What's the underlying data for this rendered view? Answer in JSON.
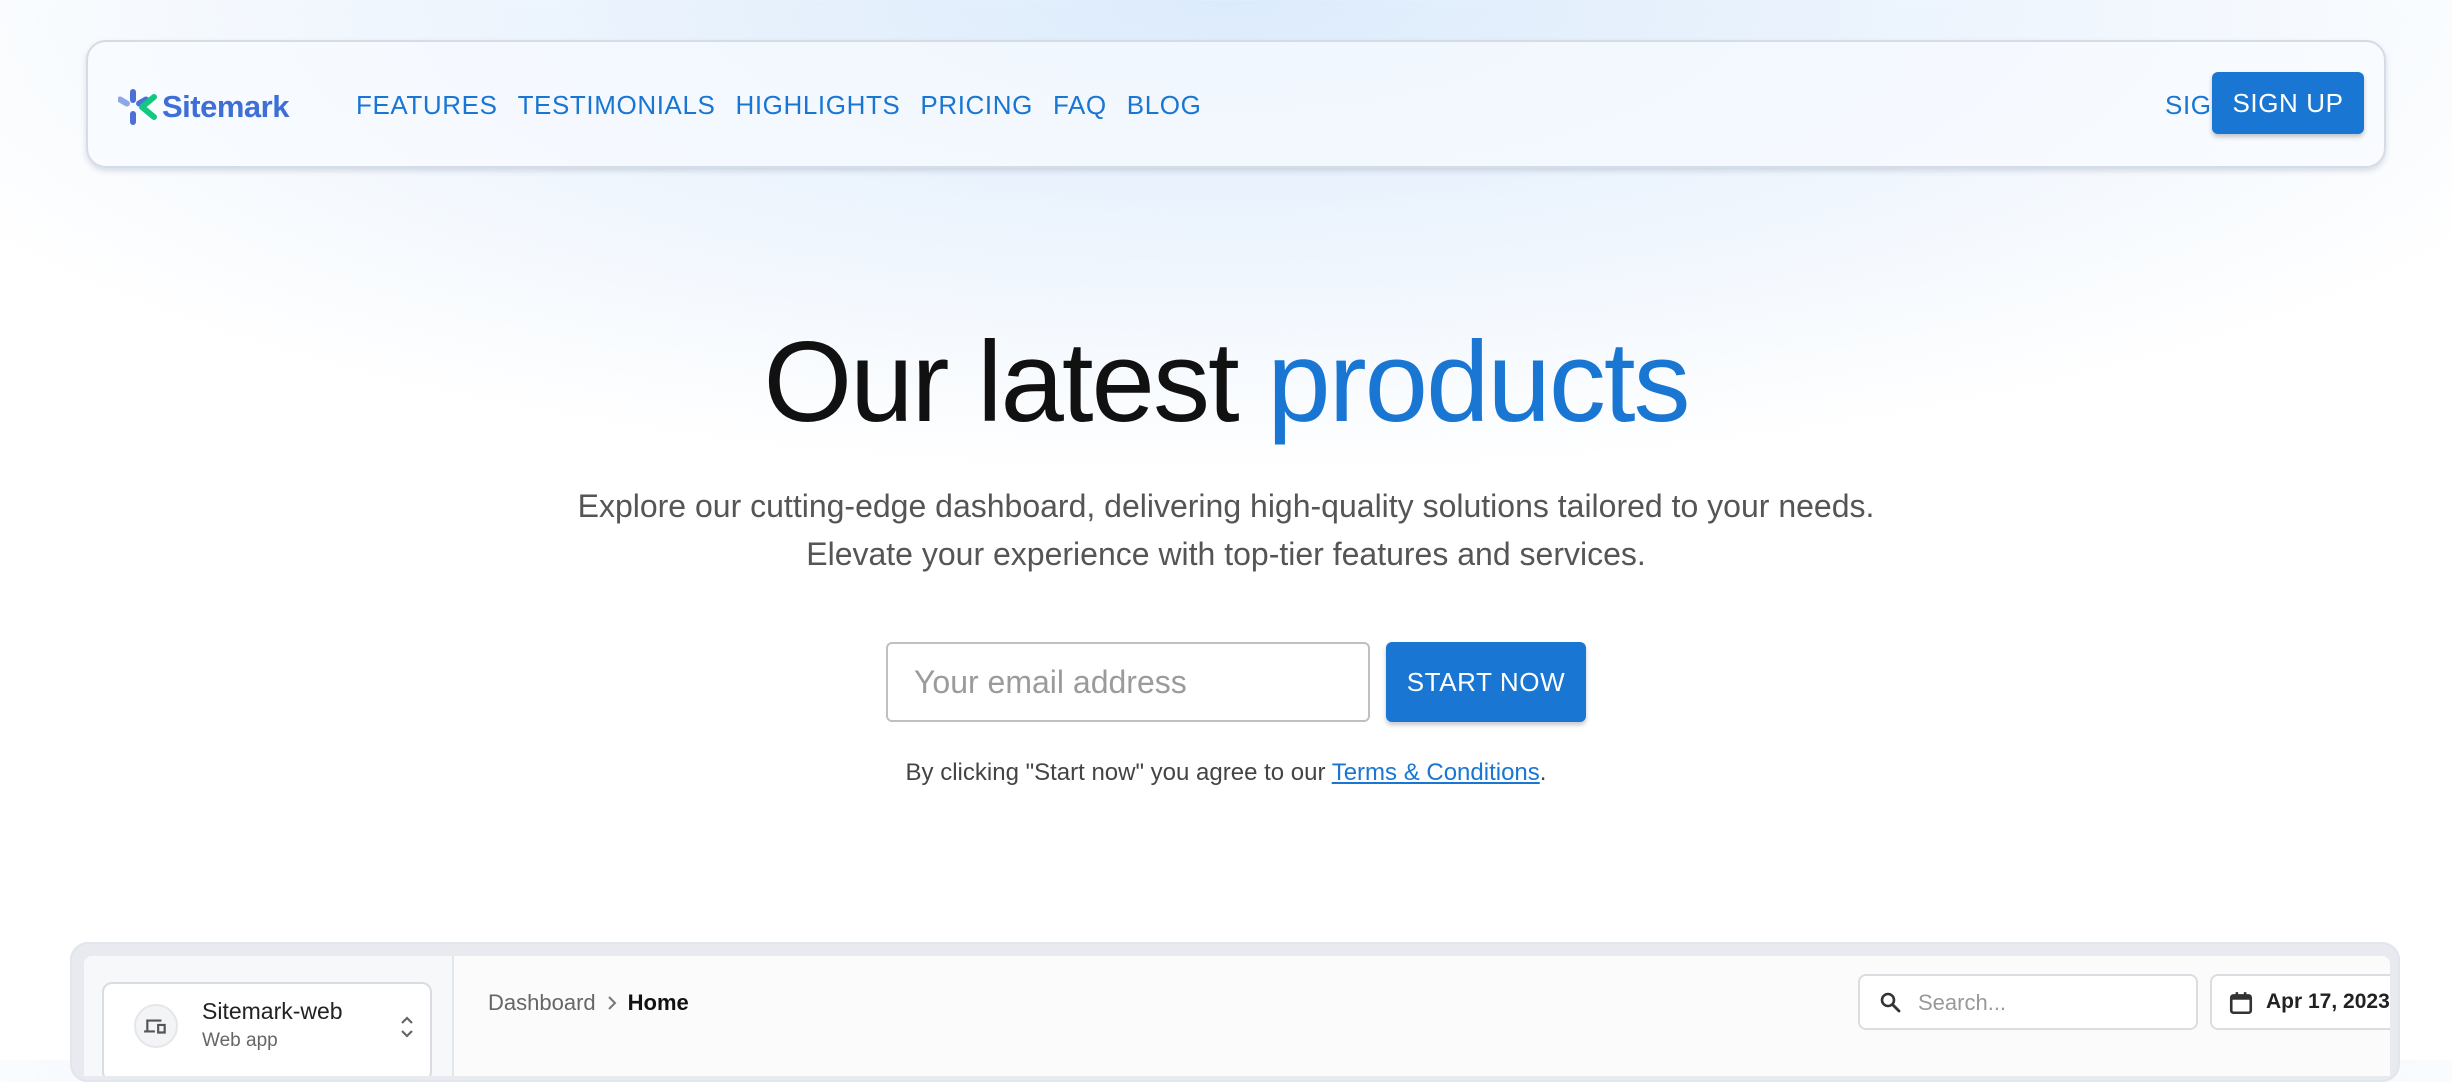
{
  "brand": {
    "name": "Sitemark"
  },
  "nav": {
    "links": [
      "FEATURES",
      "TESTIMONIALS",
      "HIGHLIGHTS",
      "PRICING",
      "FAQ",
      "BLOG"
    ],
    "sign_in": "SIGN IN",
    "sign_up": "SIGN UP"
  },
  "hero": {
    "title_part1": "Our latest ",
    "title_part2": "products",
    "subtitle": "Explore our cutting-edge dashboard, delivering high-quality solutions tailored to your needs. Elevate your experience with top-tier features and services.",
    "email_placeholder": "Your email address",
    "start_button": "START NOW",
    "consent_prefix": "By clicking \"Start now\" you agree to our ",
    "consent_link": "Terms & Conditions",
    "consent_suffix": "."
  },
  "preview": {
    "site_name": "Sitemark-web",
    "site_type": "Web app",
    "breadcrumb": [
      "Dashboard",
      "Home"
    ],
    "search_placeholder": "Search...",
    "date": "Apr 17, 2023"
  },
  "colors": {
    "primary": "#1976d2",
    "brand_text": "#3d6fd6",
    "logo_green": "#12c77e",
    "logo_blue": "#4f6fd8"
  },
  "icons": [
    "sitemark-logo-icon",
    "devices-icon",
    "unfold-icon",
    "chevron-right-icon",
    "search-icon",
    "calendar-icon"
  ]
}
